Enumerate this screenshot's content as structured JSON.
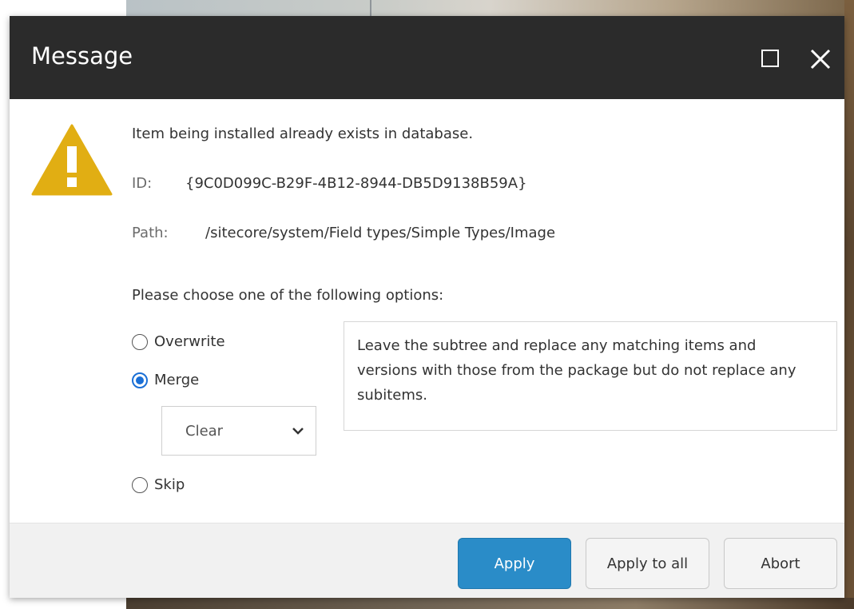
{
  "dialog": {
    "title": "Message",
    "message": "Item being installed already exists in database.",
    "id_label": "ID:",
    "id_value": "{9C0D099C-B29F-4B12-8944-DB5D9138B59A}",
    "path_label": "Path:",
    "path_value": "/sitecore/system/Field types/Simple Types/Image",
    "prompt": "Please choose one of the following options:",
    "options": [
      {
        "label": "Overwrite",
        "checked": false
      },
      {
        "label": "Merge",
        "checked": true
      },
      {
        "label": "Skip",
        "checked": false
      }
    ],
    "merge_mode": {
      "selected": "Clear"
    },
    "description": "Leave the subtree and replace any matching items and versions with those from the package but do not replace any subitems.",
    "buttons": {
      "apply": "Apply",
      "apply_all": "Apply to all",
      "abort": "Abort"
    },
    "icons": {
      "warning": "warning-icon",
      "maximize": "maximize-icon",
      "close": "close-icon",
      "chevron": "chevron-down-icon"
    },
    "colors": {
      "titlebar": "#2b2b2b",
      "warning": "#e1ae13",
      "primary_button": "#2a8cc8",
      "radio_checked": "#1a6fd6"
    }
  }
}
